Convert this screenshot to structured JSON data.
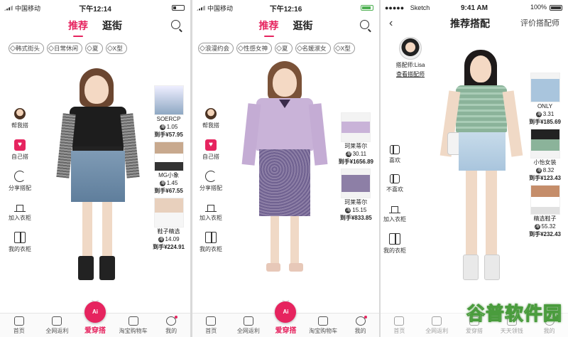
{
  "panel1": {
    "status": {
      "carrier": "中国移动",
      "time": "下午12:14"
    },
    "tabs": [
      "推荐",
      "逛街"
    ],
    "chips": [
      "韩式街头",
      "日常休闲",
      "夏",
      "X型"
    ],
    "tools": [
      "帮我搭",
      "自己搭",
      "分享搭配",
      "加入衣柜",
      "我的衣柜"
    ],
    "items": [
      {
        "name": "SOERCP",
        "price": "1.05",
        "final": "到手¥57.95"
      },
      {
        "name": "MG小象",
        "price": "1.45",
        "final": "到手¥67.55"
      },
      {
        "name": "鞋子精选",
        "price": "14.09",
        "final": "到手¥224.91"
      }
    ],
    "bottom": [
      "首页",
      "全网返利",
      "爱穿搭",
      "淘宝购物车",
      "我的"
    ],
    "ai_label": "Ai"
  },
  "panel2": {
    "status": {
      "carrier": "中国移动",
      "time": "下午12:16"
    },
    "tabs": [
      "推荐",
      "逛街"
    ],
    "chips": [
      "浪漫约会",
      "性感女神",
      "夏",
      "名媛淑女",
      "X型"
    ],
    "tools": [
      "帮我搭",
      "自己搭",
      "分享搭配",
      "加入衣柜",
      "我的衣柜"
    ],
    "items": [
      {
        "name": "珂莱蒂尔",
        "price": "30.11",
        "final": "到手¥1656.89"
      },
      {
        "name": "珂莱蒂尔",
        "price": "15.15",
        "final": "到手¥833.85"
      }
    ],
    "bottom": [
      "首页",
      "全网返利",
      "爱穿搭",
      "淘宝购物车",
      "我的"
    ],
    "ai_label": "Ai"
  },
  "panel3": {
    "status": {
      "carrier": "Sketch",
      "time": "9:41 AM",
      "battery": "100%"
    },
    "title": "推荐搭配",
    "right_link": "评价搭配师",
    "stylist": {
      "name": "搭配师:Lisa",
      "link": "查看搭配师"
    },
    "tools": [
      "喜欢",
      "不喜欢",
      "加入衣柜",
      "我的衣柜"
    ],
    "items": [
      {
        "name": "ONLY",
        "price": "3.31",
        "final": "到手¥185.69"
      },
      {
        "name": "小怡女装",
        "price": "8.32",
        "final": "到手¥123.43"
      },
      {
        "name": "精选鞋子",
        "price": "55.32",
        "final": "到手¥232.43"
      }
    ],
    "bottom": [
      "首页",
      "全网返利",
      "爱穿搭",
      "天天领钱",
      "我的"
    ],
    "watermark": "谷普软件园"
  },
  "icons": {
    "taobao": "淘"
  },
  "colors": {
    "accent": "#e6245f",
    "watermark": "#4a9c3d"
  }
}
